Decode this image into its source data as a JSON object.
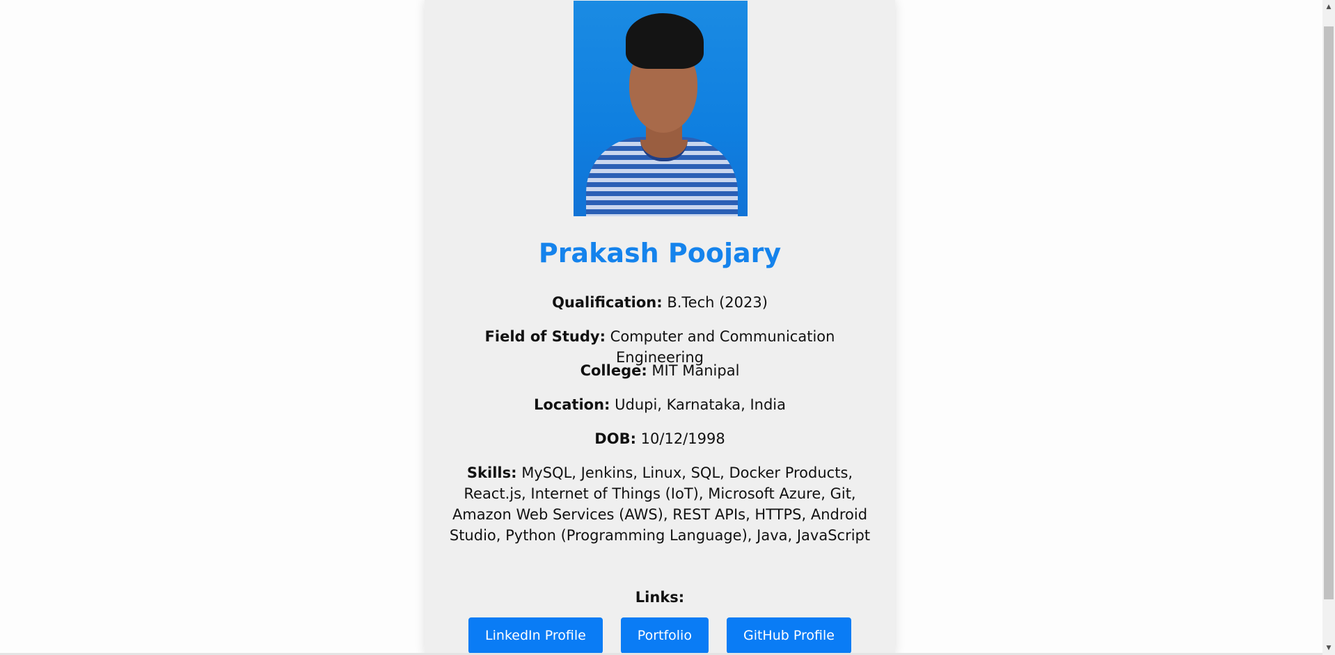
{
  "profile": {
    "photo_alt": "Profile photo",
    "name": "Prakash Poojary",
    "qualification": {
      "label": "Qualification:",
      "value": " B.Tech (2023)"
    },
    "field_of_study": {
      "label": "Field of Study:",
      "value": " Computer and Communication Engineering"
    },
    "college": {
      "label": "College:",
      "value": " MIT Manipal"
    },
    "location": {
      "label": "Location:",
      "value": " Udupi, Karnataka, India"
    },
    "dob": {
      "label": "DOB:",
      "value": " 10/12/1998"
    },
    "skills": {
      "label": "Skills:",
      "value": " MySQL, Jenkins, Linux, SQL, Docker Products, React.js, Internet of Things (IoT), Microsoft Azure, Git, Amazon Web Services (AWS), REST APIs, HTTPS, Android Studio, Python (Programming Language), Java, JavaScript"
    }
  },
  "links": {
    "title": "Links:",
    "buttons": [
      "LinkedIn Profile",
      "Portfolio",
      "GitHub Profile"
    ]
  },
  "colors": {
    "accent": "#1583ec",
    "button": "#0a7cf5",
    "card_background": "#efefef"
  }
}
